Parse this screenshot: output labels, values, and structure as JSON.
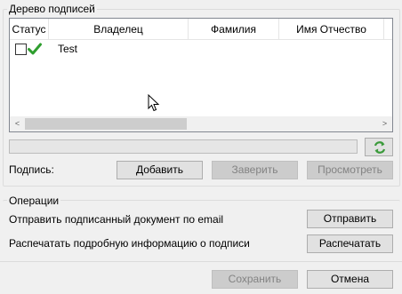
{
  "tree_group": {
    "title": "Дерево подписей",
    "columns": [
      "Статус",
      "Владелец",
      "Фамилия",
      "Имя Отчество"
    ],
    "rows": [
      {
        "owner": "Test",
        "checked": false,
        "status_icon": "green-checkmark-icon"
      }
    ],
    "scroll_left": "<",
    "scroll_right": ">"
  },
  "signature": {
    "label": "Подпись:",
    "add_button": "Добавить",
    "certify_button": "Заверить",
    "view_button": "Просмотреть"
  },
  "operations": {
    "title": "Операции",
    "email_text": "Отправить подписанный документ по email",
    "email_button": "Отправить",
    "print_text": "Распечатать подробную информацию о подписи",
    "print_button": "Распечатать"
  },
  "footer": {
    "save_button": "Сохранить",
    "cancel_button": "Отмена"
  },
  "colors": {
    "check_green": "#2e9e2e",
    "refresh_green": "#3a9a3a",
    "button_face": "#e1e1e1",
    "button_disabled": "#cccccc"
  }
}
